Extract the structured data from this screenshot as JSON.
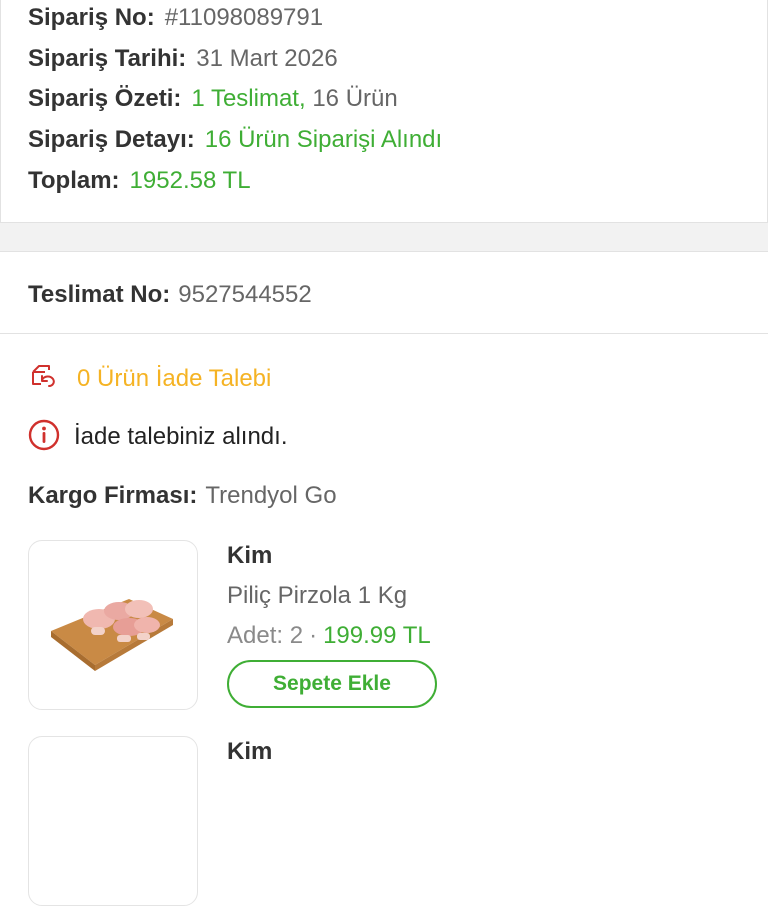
{
  "order": {
    "number_label": "Sipariş No:",
    "number_value": "#11098089791",
    "date_label": "Sipariş Tarihi:",
    "date_value": "31 Mart 2026",
    "summary_label": "Sipariş Özeti:",
    "summary_value_green": "1 Teslimat,",
    "summary_value_gray": "16 Ürün",
    "detail_label": "Sipariş Detayı:",
    "detail_value": "16 Ürün Siparişi Alındı",
    "total_label": "Toplam:",
    "total_value": "1952.58 TL"
  },
  "delivery": {
    "label": "Teslimat No:",
    "value": "9527544552",
    "return_request": "0 Ürün İade Talebi",
    "return_info": "İade talebiniz alındı.",
    "cargo_label": "Kargo Firması:",
    "cargo_value": "Trendyol Go"
  },
  "products": [
    {
      "brand": "Kim",
      "name": "Piliç Pirzola 1 Kg",
      "qty_label": "Adet:",
      "qty_value": "2",
      "separator": "·",
      "price": "199.99 TL",
      "add_button": "Sepete Ekle"
    },
    {
      "brand": "Kim"
    }
  ],
  "colors": {
    "green": "#3fae35",
    "yellow": "#f5b324",
    "red": "#d0312d",
    "divider": "#e2e2e2"
  },
  "icons": {
    "return": "return-package-icon",
    "info": "info-circle-icon"
  }
}
